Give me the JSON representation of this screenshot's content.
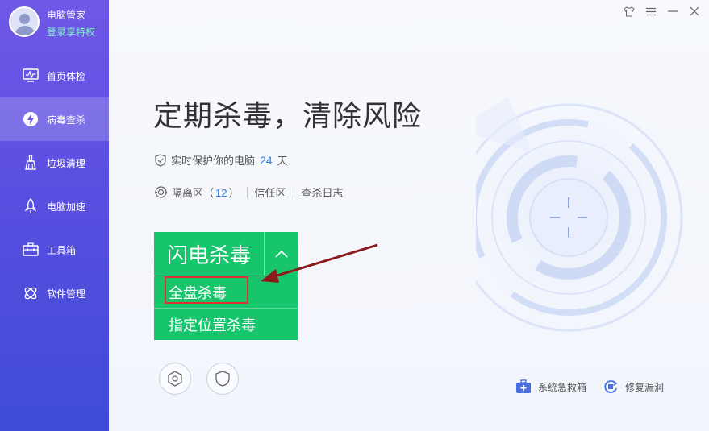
{
  "app": {
    "name": "电脑管家",
    "login": "登录享特权"
  },
  "sidebar": {
    "items": [
      {
        "label": "首页体检",
        "icon": "monitor-icon"
      },
      {
        "label": "病毒查杀",
        "icon": "lightning-shield-icon",
        "active": true
      },
      {
        "label": "垃圾清理",
        "icon": "broom-icon"
      },
      {
        "label": "电脑加速",
        "icon": "rocket-icon"
      },
      {
        "label": "工具箱",
        "icon": "toolbox-icon"
      },
      {
        "label": "软件管理",
        "icon": "apps-icon"
      }
    ]
  },
  "window": {
    "controls": [
      "skin-icon",
      "menu-icon",
      "minimize-icon",
      "close-icon"
    ]
  },
  "main": {
    "headline": "定期杀毒，清除风险",
    "protect_text": "实时保护你的电脑",
    "protect_days": "24",
    "protect_unit": "天",
    "quarantine_label": "隔离区",
    "quarantine_open": "（",
    "quarantine_count": "12",
    "quarantine_close": "）",
    "trust_label": "信任区",
    "log_label": "查杀日志"
  },
  "scan": {
    "main_label": "闪电杀毒",
    "options": [
      "全盘杀毒",
      "指定位置杀毒"
    ],
    "highlighted": "全盘杀毒"
  },
  "tools": [
    {
      "label": "系统急救箱",
      "icon": "first-aid-kit-icon"
    },
    {
      "label": "修复漏洞",
      "icon": "repair-vulnerability-icon"
    }
  ],
  "colors": {
    "sidebar_top": "#6f58e6",
    "sidebar_bottom": "#3e4bd6",
    "scan_green": "#17c56c",
    "accent_blue": "#2b7be0",
    "highlight_red": "#e0302c",
    "arrow": "#8b1a1a"
  }
}
